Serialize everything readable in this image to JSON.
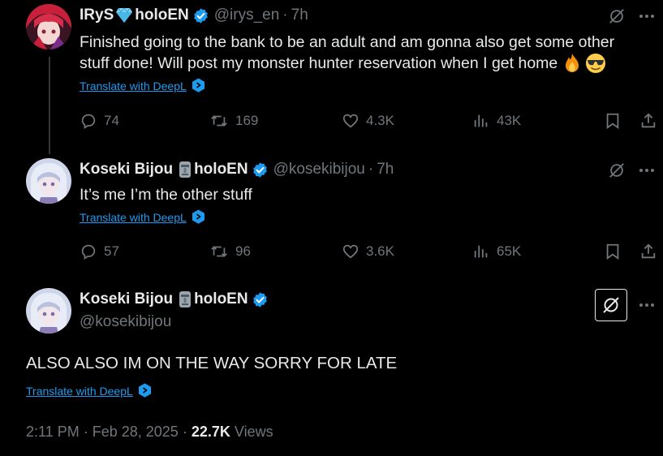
{
  "colors": {
    "background": "#000000",
    "text": "#e7e9ea",
    "muted": "#71767b",
    "link": "#1d9bf0",
    "verified": "#1d9bf0"
  },
  "tweets": [
    {
      "name": "IRyS",
      "name_suffix": "holoEN",
      "name_emoji": "gem-icon",
      "handle": "@irys_en",
      "time": "7h",
      "text_line1": "Finished going to the bank to be an adult and am gonna also get some other",
      "text_line2": "stuff done! Will post my monster hunter reservation when I get home",
      "text_emojis": [
        "fire-emoji",
        "sunglasses-emoji"
      ],
      "translate": "Translate with DeepL",
      "replies": "74",
      "reposts": "169",
      "likes": "4.3K",
      "views": "43K"
    },
    {
      "name": "Koseki Bijou",
      "name_suffix": "holoEN",
      "name_emoji": "moai-icon",
      "handle": "@kosekibijou",
      "time": "7h",
      "text": "It’s me I’m the other stuff",
      "translate": "Translate with DeepL",
      "replies": "57",
      "reposts": "96",
      "likes": "3.6K",
      "views": "65K"
    }
  ],
  "main": {
    "name": "Koseki Bijou",
    "name_suffix": "holoEN",
    "name_emoji": "moai-icon",
    "handle": "@kosekibijou",
    "text": "ALSO ALSO IM ON THE WAY SORRY FOR LATE",
    "translate": "Translate with DeepL",
    "time": "2:11 PM",
    "date": "Feb 28, 2025",
    "views_count": "22.7K",
    "views_label": "Views"
  }
}
